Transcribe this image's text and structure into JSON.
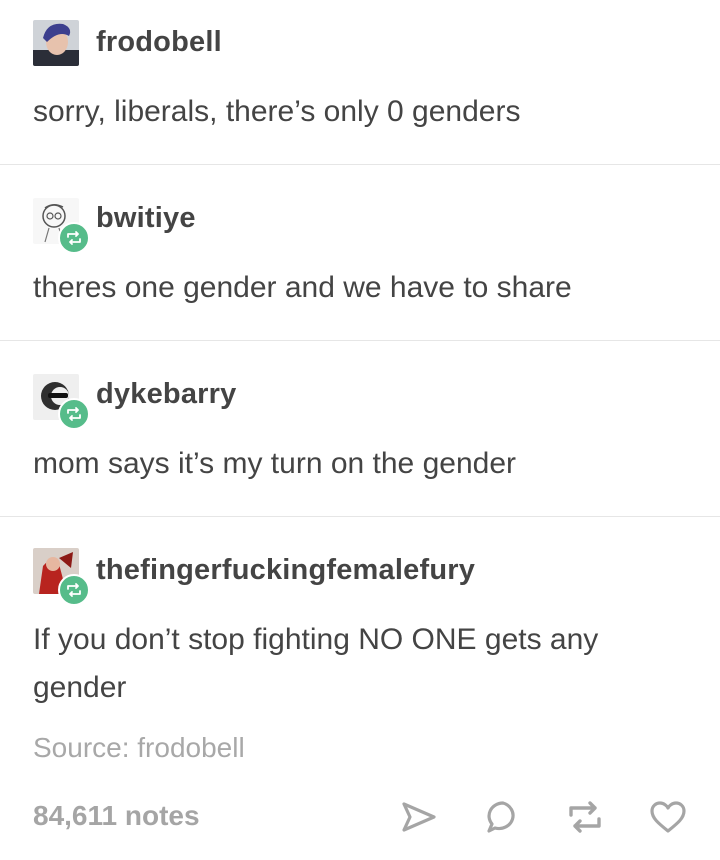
{
  "posts": [
    {
      "username": "frodobell",
      "text": "sorry, liberals, there’s only 0 genders",
      "reblog": false
    },
    {
      "username": "bwitiye",
      "text": "theres one gender and we have to share",
      "reblog": true
    },
    {
      "username": "dykebarry",
      "text": "mom says it’s my turn on the gender",
      "reblog": true
    },
    {
      "username": "thefingerfuckingfemalefury",
      "text": "If you don’t stop fighting NO ONE gets any gender",
      "reblog": true
    }
  ],
  "source": {
    "text": "Source: frodobell"
  },
  "footer": {
    "notes": "84,611 notes",
    "actions": [
      "share-icon",
      "reply-icon",
      "reblog-icon",
      "like-icon"
    ]
  },
  "colors": {
    "text": "#444444",
    "muted": "#a5a5a5",
    "reblog_badge": "#56bc8a",
    "divider": "#e6e6e6"
  }
}
